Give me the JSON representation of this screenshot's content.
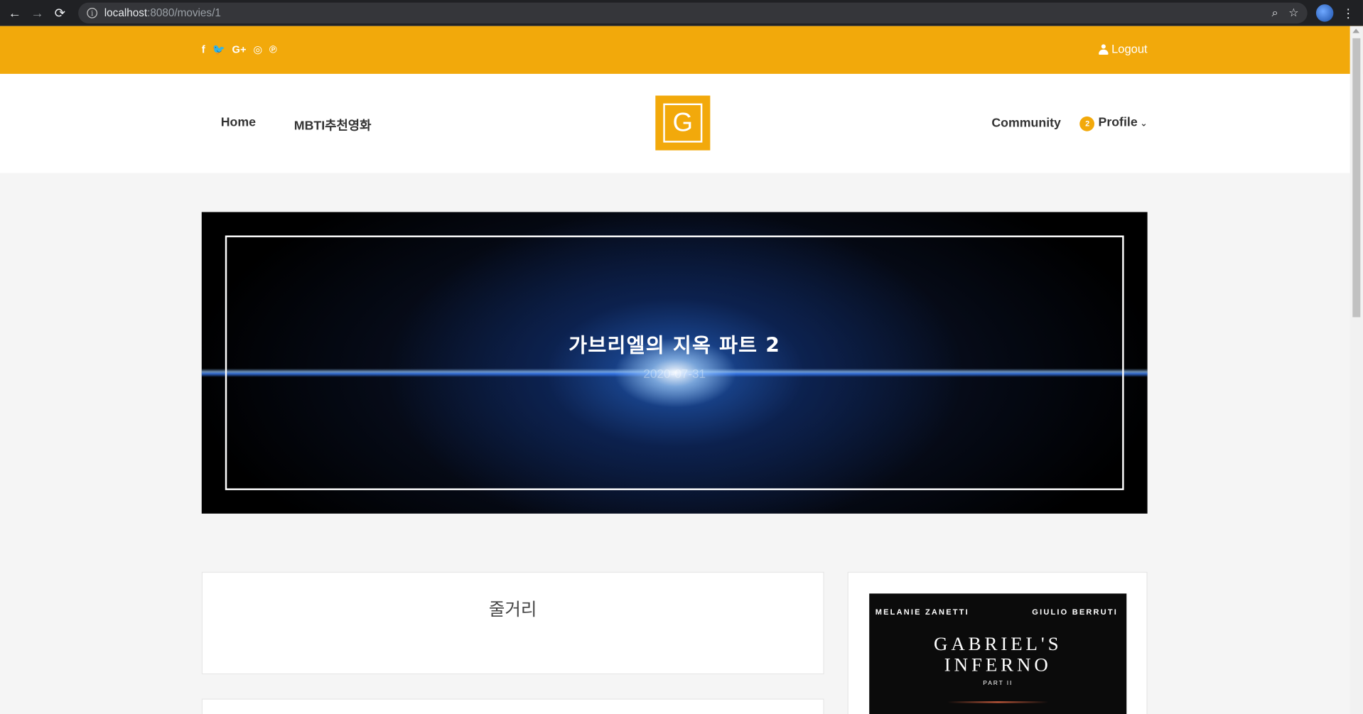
{
  "browser": {
    "url_host": "localhost",
    "url_rest": ":8080/movies/1",
    "back_icon": "←",
    "forward_icon": "→",
    "reload_icon": "⟳",
    "zoom_icon": "⌕",
    "star_icon": "☆",
    "menu_icon": "⋮",
    "info_icon": "i"
  },
  "topbar": {
    "social": [
      "f",
      "🐦",
      "G+",
      "◎",
      "℗"
    ],
    "logout_label": "Logout"
  },
  "nav": {
    "home": "Home",
    "mbti": "MBTI추천영화",
    "logo_letter": "G",
    "community": "Community",
    "profile_badge": "2",
    "profile": "Profile",
    "chevron": "⌄"
  },
  "hero": {
    "title": "가브리엘의 지옥 파트 2",
    "date": "2020-07-31"
  },
  "synopsis": {
    "heading": "줄거리"
  },
  "poster": {
    "actor_left": "MELANIE ZANETTI",
    "actor_right": "GIULIO BERRUTI",
    "title_line1": "GABRIEL'S",
    "title_line2": "INFERNO",
    "subtitle": "PART II"
  },
  "colors": {
    "accent": "#f2a90b"
  }
}
